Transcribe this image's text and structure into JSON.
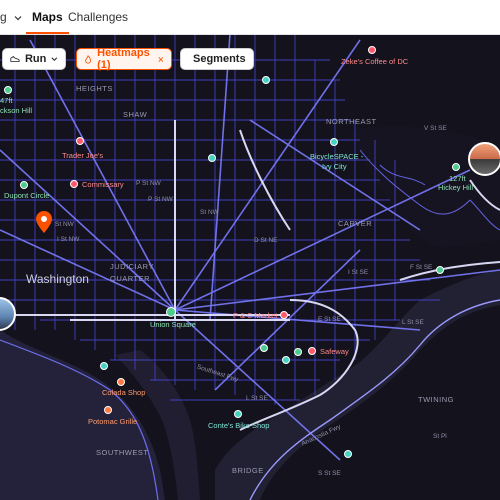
{
  "nav": {
    "tab_cut": "g",
    "tab_maps": "Maps",
    "tab_challenges": "Challenges"
  },
  "filters": {
    "sport": "Run",
    "heatmaps": "Heatmaps (1)",
    "segments": "Segments"
  },
  "pois": {
    "zekes": "Zeke's Coffee of DC",
    "trader_joes": "Trader Joe's",
    "commissary": "Commissary",
    "dupont": "Dupont Circle",
    "bicyclespace": "BicycleSPACE -",
    "bicyclespace_2": "Ivy City",
    "hickey": "127ft",
    "hickey_2": "Hickey Hill",
    "union_square": "Union Square",
    "pc_market": "P & C Market",
    "safeway": "Safeway",
    "colada": "Colada Shop",
    "potomac": "Potomac Grille",
    "contes": "Conte's Bike Shop",
    "peak_left": "47ft",
    "peak_left_2": "ckson Hill"
  },
  "labels": {
    "washington": "Washington",
    "northeast": "NORTHEAST",
    "carver": "CARVER",
    "southwest": "SOUTHWEST",
    "twining": "TWINING",
    "shaw": "SHAW",
    "heights": "HEIGHTS",
    "judiciary": "JUDICIARY",
    "quarter": "QUARTER",
    "bridge": "BRIDGE",
    "p_st": "P St NW",
    "p_st_2": "P St NW",
    "st_nw_1": "St NW",
    "st_nw_2": "I St NW",
    "st_nw_3": "St NW",
    "st_nw_4": "St NW",
    "v_st": "V St SE",
    "d_st": "D St NE",
    "i_se": "I St SE",
    "f_se": "F St SE",
    "e_se": "E St SE",
    "l_se": "L St SE",
    "l_se_2": "L St SE",
    "s_se": "S St SE",
    "southeast_fwy": "Southeast Fwy",
    "st_pl": "St Pl",
    "anacostia": "Anacostia Fwy"
  },
  "colors": {
    "accent": "#fc5200",
    "map_bg": "#14121d",
    "heat": "#5b5cff",
    "heat_hot": "#e3e3ff",
    "poi_green": "#4ecb8f",
    "poi_red": "#ff5a6b",
    "poi_teal": "#46d3c2",
    "poi_orange": "#ff7a45"
  }
}
